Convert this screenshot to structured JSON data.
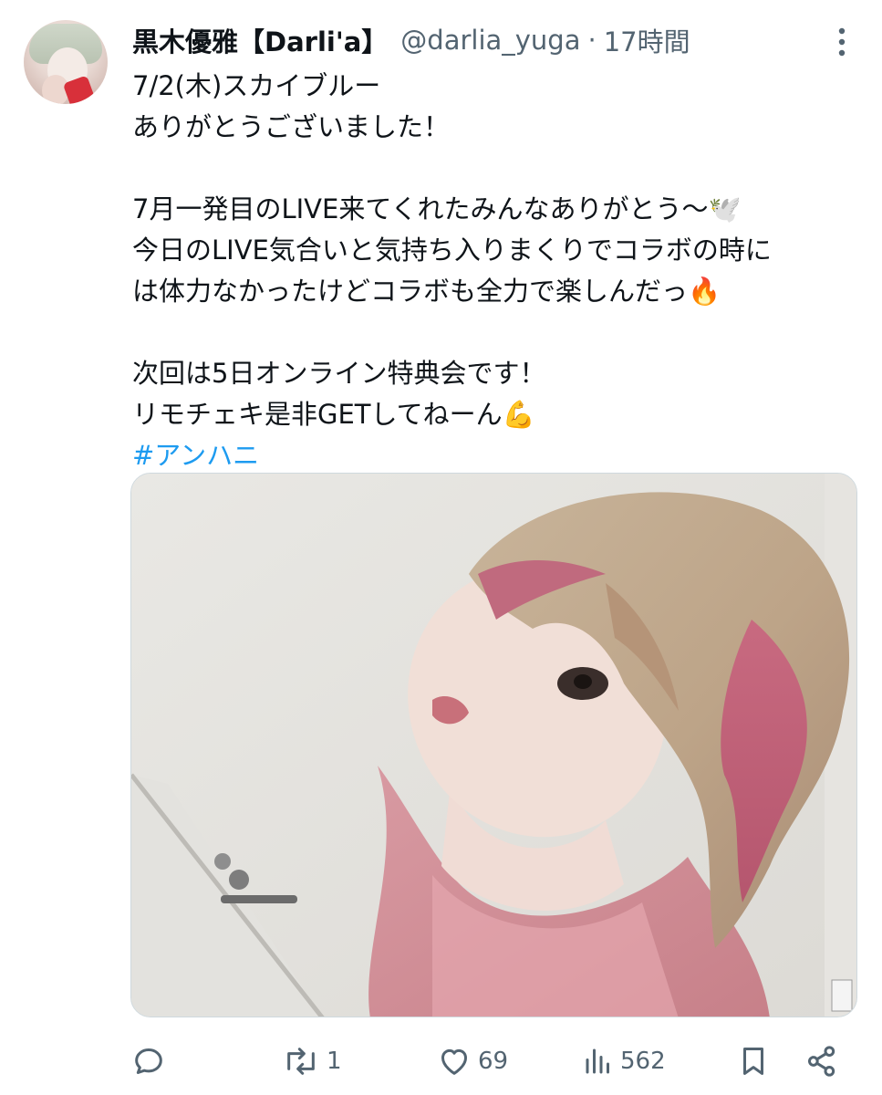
{
  "author": {
    "display_name": "黒木優雅【Darli'a】",
    "handle": "@darlia_yuga",
    "separator": "·",
    "time": "17時間"
  },
  "tweet": {
    "lines": [
      "7/2(木)スカイブルー",
      "ありがとうございました！",
      "",
      "7月一発目のLIVE来てくれたみんなありがとう〜🕊️",
      "今日のLIVE気合いと気持ち入りまくりでコラボの時に",
      "は体力なかったけどコラボも全力で楽しんだっ🔥",
      "",
      "次回は5日オンライン特典会です！",
      "リモチェキ是非GETしてねーん💪"
    ],
    "hashtag": "#アンハニ"
  },
  "media": {
    "icon": "photo-selfie"
  },
  "actions": {
    "reply_count": "",
    "retweet_count": "1",
    "like_count": "69",
    "views_count": "562"
  },
  "colors": {
    "text": "#0f1419",
    "secondary": "#536471",
    "link": "#1d9bf0"
  }
}
